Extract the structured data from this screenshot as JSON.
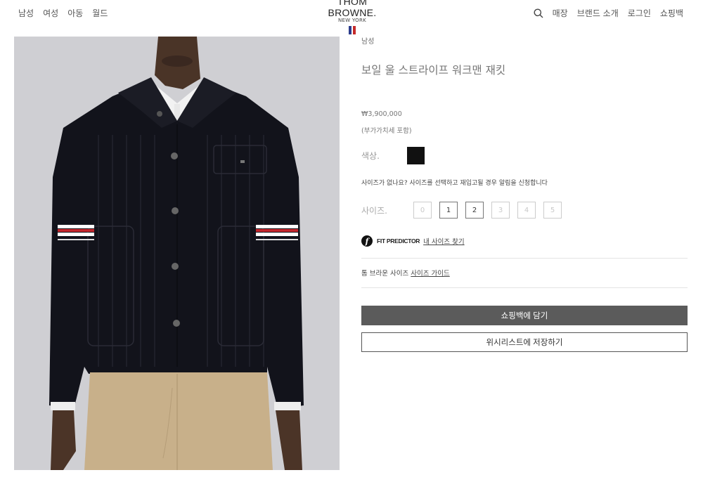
{
  "header": {
    "nav_left": [
      "남성",
      "여성",
      "아동",
      "월드"
    ],
    "logo": {
      "brand": "THOM BROWNE.",
      "sub": "NEW YORK"
    },
    "nav_right": [
      "매장",
      "브랜드 소개",
      "로그인",
      "쇼핑백"
    ],
    "icons": {
      "search": "search-icon"
    },
    "flag_colors": [
      "#2c3c8c",
      "#ffffff",
      "#c52a2a"
    ]
  },
  "product": {
    "category": "남성",
    "title": "보일 울 스트라이프 워크맨 재킷",
    "price": "₩3,900,000",
    "vat_note": "(부가가치세 포함)",
    "color_label": "색상.",
    "color_swatch": "#111111",
    "size_notice": "사이즈가 없나요? 사이즈를 선택하고 재입고될 경우 알림을 신청합니다",
    "size_label": "사이즈.",
    "sizes": [
      {
        "label": "0",
        "available": false
      },
      {
        "label": "1",
        "available": true
      },
      {
        "label": "2",
        "available": true
      },
      {
        "label": "3",
        "available": false
      },
      {
        "label": "4",
        "available": false
      },
      {
        "label": "5",
        "available": false
      }
    ],
    "fit_predictor": {
      "icon": "f",
      "label": "FIT PREDICTOR",
      "link": "내 사이즈 찾기"
    },
    "size_guide": {
      "prefix": "톰 브라운 사이즈",
      "link": "사이즈 가이드"
    },
    "add_to_bag": "쇼핑백에 담기",
    "add_to_wishlist": "위시리스트에 저장하기"
  }
}
